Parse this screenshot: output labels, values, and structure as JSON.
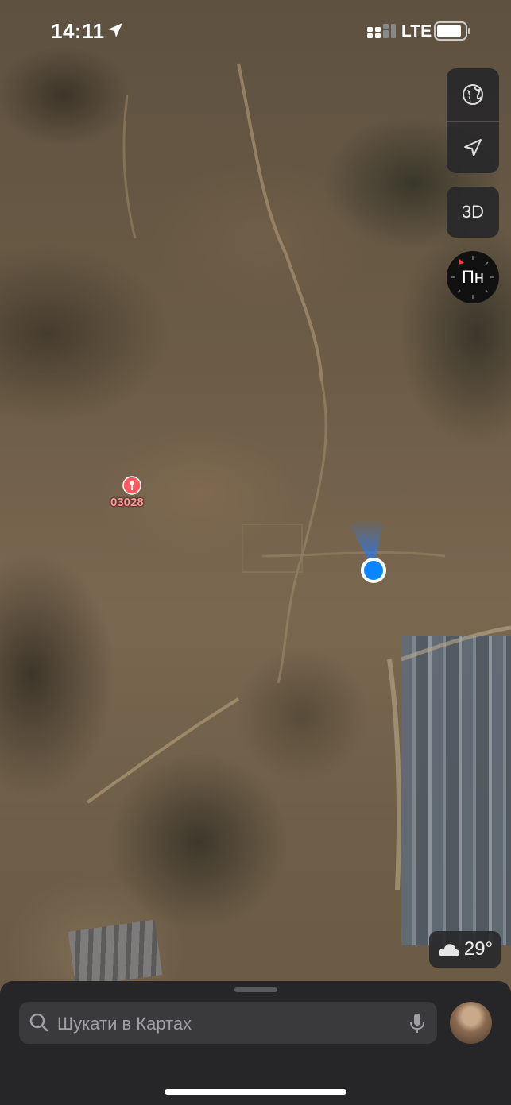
{
  "status_bar": {
    "time": "14:11",
    "network": "LTE"
  },
  "map": {
    "pin_label": "03028",
    "user_location_color": "#0a84ff"
  },
  "controls": {
    "map_mode_icon": "globe-icon",
    "locate_icon": "location-arrow-icon",
    "threed_label": "3D",
    "compass_label": "Пн"
  },
  "weather": {
    "icon": "cloud-icon",
    "temperature": "29°"
  },
  "search": {
    "placeholder": "Шукати в Картах"
  }
}
